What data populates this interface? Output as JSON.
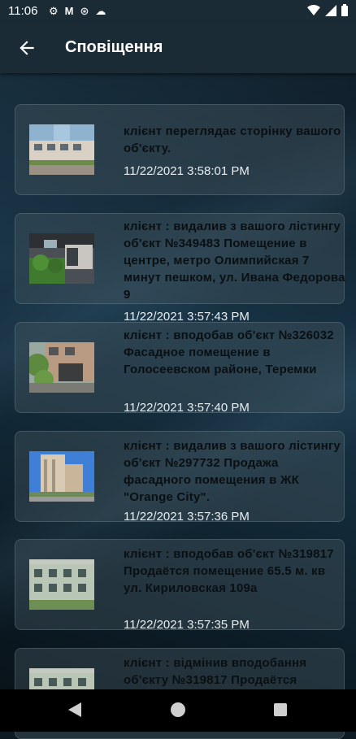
{
  "status_bar": {
    "time": "11:06"
  },
  "app_bar": {
    "title": "Сповіщення"
  },
  "notifications": [
    {
      "text": "клієнт переглядає сторінку вашого об'єкту.",
      "time": "11/22/2021 3:58:01 PM"
    },
    {
      "text": "клієнт :  видалив з вашого лістингу об'єкт №349483 Помещение в центре, метро Олимпийская 7 минут пешком, ул. Ивана Федорова 9",
      "time": "11/22/2021 3:57:43 PM"
    },
    {
      "text": "клієнт :  вподобав об'єкт №326032 Фасадное помещение в Голосеевском районе, Теремки",
      "time": "11/22/2021 3:57:40 PM"
    },
    {
      "text": "клієнт :  видалив з вашого лістингу об'єкт №297732 Продажа фасадного помещения в ЖК \"Orange City\".",
      "time": "11/22/2021 3:57:36 PM"
    },
    {
      "text": "клієнт :  вподобав об'єкт №319817 Продаётся помещение 65.5 м. кв ул. Кириловская 109а",
      "time": "11/22/2021 3:57:35 PM"
    },
    {
      "text": "клієнт :  відмінив вподобання об'єкту №319817 Продаётся",
      "time": ""
    }
  ]
}
